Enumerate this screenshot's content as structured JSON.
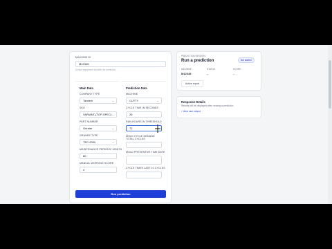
{
  "form": {
    "machine_id": {
      "label": "MACHINE ID",
      "value": "M12345",
      "hint": "Unique equipment identifier for prediction"
    },
    "main_data": {
      "title": "Main Data",
      "fields": [
        {
          "label": "COMPANY TYPE",
          "value": "Tandem"
        },
        {
          "label": "SKU",
          "value": "VARIANT-(TOP-SPEC)"
        },
        {
          "label": "PART NUMBER",
          "value": "Grinder"
        },
        {
          "label": "GRANDE TYPE",
          "value": "TEC-2000"
        },
        {
          "label": "MAINTENANCE PERIODIC MONTH",
          "value": "80"
        },
        {
          "label": "MANUAL WORKING SCORE",
          "value": "4"
        }
      ]
    },
    "prediction_data": {
      "title": "Prediction Data",
      "fields": [
        {
          "label": "MACHINE",
          "value": "CUTTY"
        },
        {
          "label": "CYCLE TIME IN SECONDS",
          "value": "26"
        },
        {
          "label": "RUN HOURS IN THRESHOLD",
          "value": "72"
        },
        {
          "label": "MOLD CYCLE DEMAND TOTAL CYCLES",
          "value": ""
        },
        {
          "label": "MOLD PREVENTIVE TIME DATE",
          "value": ""
        },
        {
          "label": "CYCLE TIMES LAST 10 CYCLES",
          "value": ""
        }
      ]
    },
    "submit_label": "Run prediction"
  },
  "prediction_panel": {
    "eyebrow": "PREDICTION SESSION",
    "title": "Run a prediction",
    "badge": "Not started",
    "columns": [
      {
        "label": "MACHINE",
        "value": "M12345"
      },
      {
        "label": "STATUS",
        "value": "–"
      },
      {
        "label": "SCORE",
        "value": "–"
      }
    ],
    "report_button": "Active report"
  },
  "response_panel": {
    "title": "Response Details",
    "text": "Results will be displayed after running a prediction",
    "link": "View raw output"
  },
  "colors": {
    "primary": "#1d3fd8",
    "page_bg": "#f3f5f7",
    "frame": "#000000"
  }
}
